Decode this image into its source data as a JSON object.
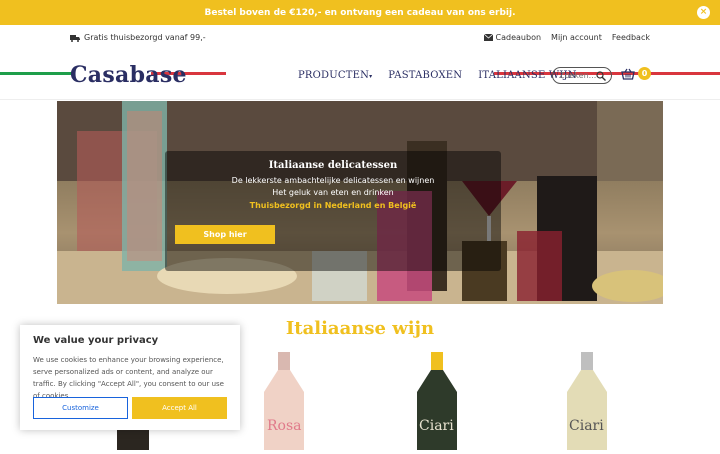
{
  "promo": {
    "text": "Bestel boven de €120,- en ontvang een cadeau van ons erbij.",
    "close_icon": "×"
  },
  "utility": {
    "shipping": "Gratis thuisbezorgd vanaf 99,-",
    "links": [
      "Cadeaubon",
      "Mijn account",
      "Feedback"
    ]
  },
  "header": {
    "logo": "Casabase",
    "nav": [
      "PRODUCTEN",
      "PASTABOXEN",
      "ITALIAANSE WIJN"
    ],
    "search_placeholder": "Zoeken...",
    "cart_count": "0"
  },
  "hero": {
    "title": "Italiaanse delicatessen",
    "line1": "De lekkerste ambachtelijke delicatessen en wijnen",
    "line2": "Het geluk van eten en drinken",
    "highlight": "Thuisbezorgd in Nederland en België",
    "button": "Shop hier"
  },
  "section": {
    "title": "Italiaanse wijn"
  },
  "wines": [
    {
      "label": "Rosa",
      "color": "#e9c5b9"
    },
    {
      "label": "Ciari",
      "color": "#2e3a2a"
    },
    {
      "label": "Ciari",
      "color": "#e3dcb6"
    }
  ],
  "cookie": {
    "title": "We value your privacy",
    "text": "We use cookies to enhance your browsing experience, serve personalized ads or content, and analyze our traffic. By clicking \"Accept All\", you consent to our use of cookies.",
    "customize": "Customize",
    "accept": "Accept All"
  },
  "colors": {
    "accent": "#f0c01f",
    "brand": "#2a2e63",
    "flag_green": "#1e9e4a",
    "flag_red": "#d9363e"
  }
}
